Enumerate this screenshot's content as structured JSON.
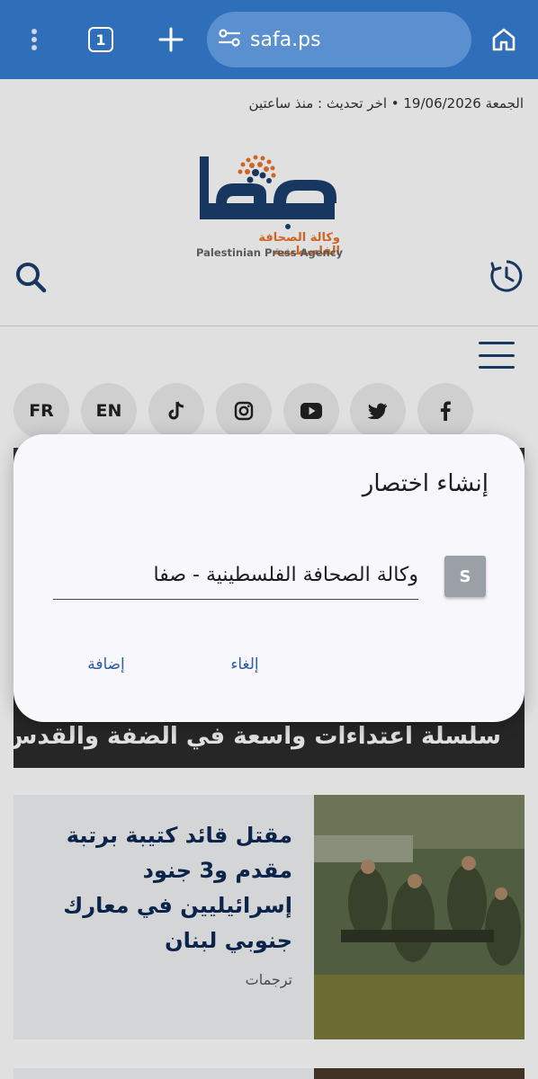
{
  "browser": {
    "url": "safa.ps",
    "tab_count": "1"
  },
  "page": {
    "dateline": "الجمعة 19/06/2026 • اخر تحديث : منذ ساعتين",
    "logo": {
      "arabic_mark": "صفا",
      "arabic_subtitle": "وكالة الصحافة الفلسطينية",
      "english_subtitle": "Palestinian Press Agency"
    },
    "social": {
      "fr": "FR",
      "en": "EN",
      "icons": [
        "tiktok-icon",
        "instagram-icon",
        "youtube-icon",
        "twitter-icon",
        "facebook-icon"
      ]
    },
    "hero_title": "سلسلة اعتداءات واسعة في الضفة والقدس",
    "card": {
      "title": "مقتل قائد كتيبة برتبة مقدم و3 جنود إسرائيليين في معارك جنوبي لبنان",
      "category": "ترجمات"
    }
  },
  "dialog": {
    "title": "إنشاء اختصار",
    "favicon_letter": "S",
    "name_value": "وكالة الصحافة الفلسطينية - صفا",
    "cancel_label": "إلغاء",
    "add_label": "إضافة"
  },
  "colors": {
    "toolbar": "#2f6fb9",
    "url_bar": "#5a8fd0",
    "brand_blue": "#1c3f6e",
    "brand_orange": "#e9742b",
    "dialog_bg": "#f8f7fc",
    "button_text": "#2d5ea1"
  }
}
